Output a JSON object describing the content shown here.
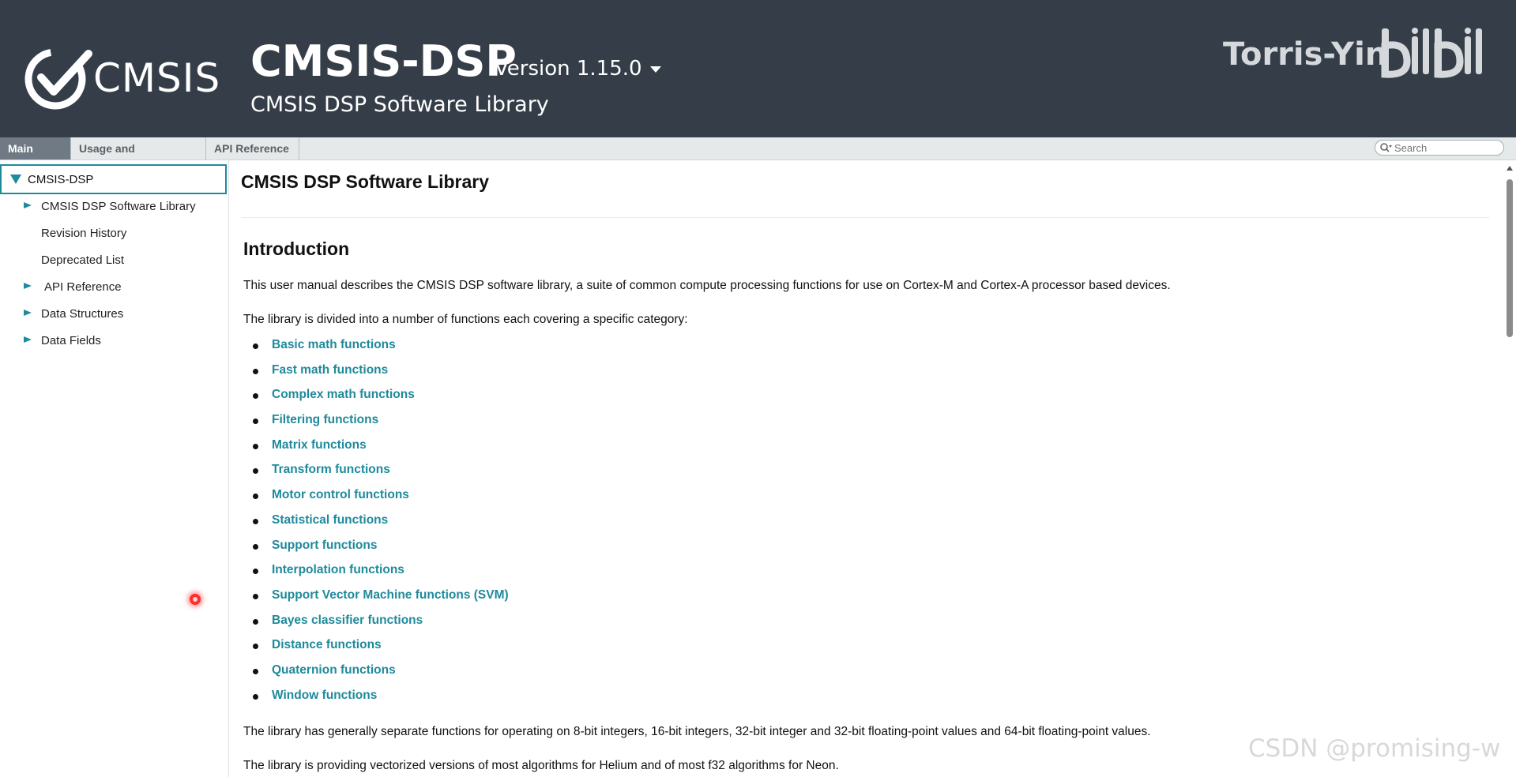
{
  "header": {
    "logo_text": "CMSIS",
    "project_name": "CMSIS-DSP",
    "version": "Version 1.15.0",
    "project_brief": "CMSIS DSP Software Library",
    "watermark_name": "Torris-Yin",
    "watermark_brand": "bilibili",
    "bg_color": "#353e48"
  },
  "navbar": {
    "tabs": [
      {
        "label": "Main Page",
        "active": true
      },
      {
        "label": "Usage and Description",
        "active": false
      },
      {
        "label": "API Reference",
        "active": false
      }
    ],
    "search": {
      "placeholder": "Search",
      "value": ""
    }
  },
  "sidebar": {
    "root": "CMSIS-DSP",
    "items": [
      {
        "label": "CMSIS DSP Software Library",
        "expandable": true
      },
      {
        "label": "Revision History",
        "expandable": false
      },
      {
        "label": "Deprecated List",
        "expandable": false
      },
      {
        "label": "API Reference",
        "expandable": true
      },
      {
        "label": "Data Structures",
        "expandable": true
      },
      {
        "label": "Data Fields",
        "expandable": true
      }
    ]
  },
  "content": {
    "title": "CMSIS DSP Software Library",
    "section_title": "Introduction",
    "intro": "This user manual describes the CMSIS DSP software library, a suite of common compute processing functions for use on Cortex-M and Cortex-A processor based devices.",
    "divided": "The library is divided into a number of functions each covering a specific category:",
    "functions": [
      "Basic math functions",
      "Fast math functions",
      "Complex math functions",
      "Filtering functions",
      "Matrix functions",
      "Transform functions",
      "Motor control functions",
      "Statistical functions",
      "Support functions",
      "Interpolation functions",
      "Support Vector Machine functions (SVM)",
      "Bayes classifier functions",
      "Distance functions",
      "Quaternion functions",
      "Window functions"
    ],
    "separate": "The library has generally separate functions for operating on 8-bit integers, 16-bit integers, 32-bit integer and 32-bit floating-point values and 64-bit floating-point values.",
    "vectorized": "The library is providing vectorized versions of most algorithms for Helium and of most f32 algorithms for Neon.",
    "link_color": "#1e8a9b"
  },
  "overlay": {
    "csdn_watermark": "CSDN @promising-w"
  }
}
